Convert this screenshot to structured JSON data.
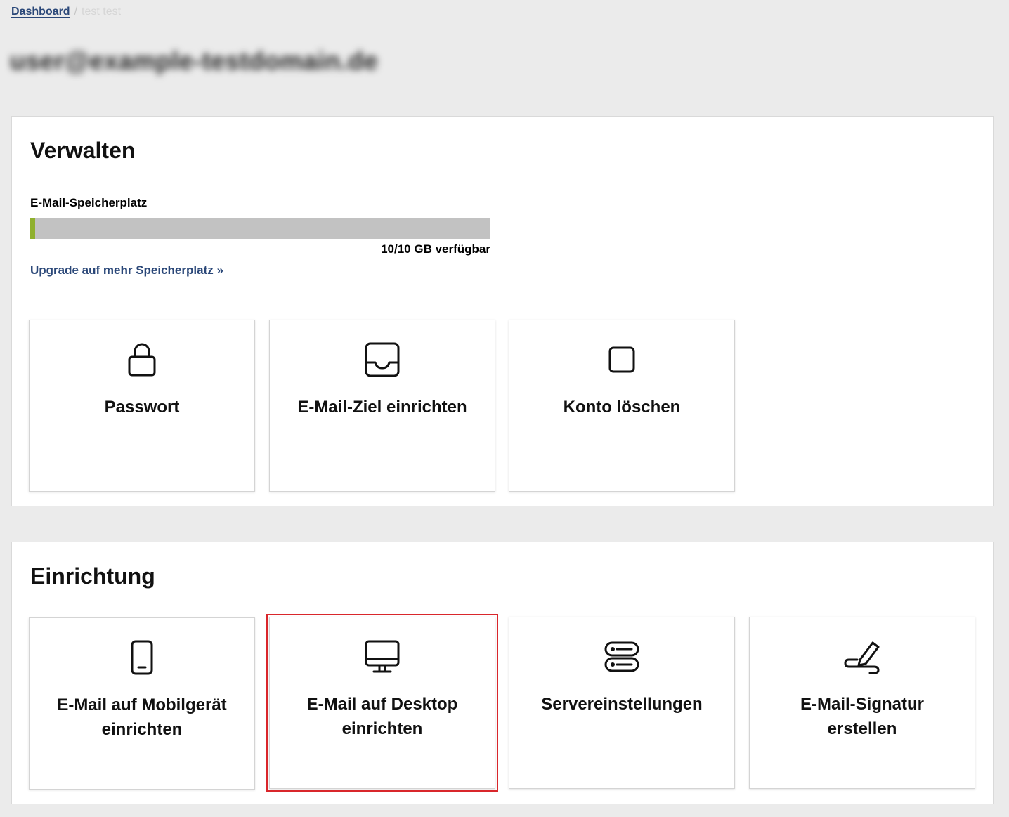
{
  "breadcrumb": {
    "dashboard": "Dashboard",
    "separator": "/",
    "current": "test test"
  },
  "account": {
    "email": "user@example-testdomain.de"
  },
  "manage": {
    "title": "Verwalten",
    "storage": {
      "label": "E-Mail-Speicherplatz",
      "used_fraction": 0.01,
      "available_text": "10/10 GB verfügbar",
      "fill_color": "#8fb02e",
      "track_color": "#c2c2c2"
    },
    "upgrade_link": "Upgrade auf mehr Speicherplatz »",
    "tiles": [
      {
        "label": "Passwort",
        "icon": "lock-icon"
      },
      {
        "label": "E-Mail-Ziel einrichten",
        "icon": "inbox-tray-icon"
      },
      {
        "label": "Konto löschen",
        "icon": "square-icon"
      }
    ]
  },
  "setup": {
    "title": "Einrichtung",
    "tiles": [
      {
        "label": "E-Mail auf Mobilgerät einrichten",
        "icon": "smartphone-icon"
      },
      {
        "label": "E-Mail auf Desktop einrichten",
        "icon": "desktop-monitor-icon",
        "highlighted": true
      },
      {
        "label": "Servereinstellungen",
        "icon": "server-icon"
      },
      {
        "label": "E-Mail-Signatur erstellen",
        "icon": "signature-pen-icon"
      }
    ]
  },
  "colors": {
    "page_background": "#ebebeb",
    "link": "#2a4778",
    "highlight_border": "#d9262b"
  }
}
